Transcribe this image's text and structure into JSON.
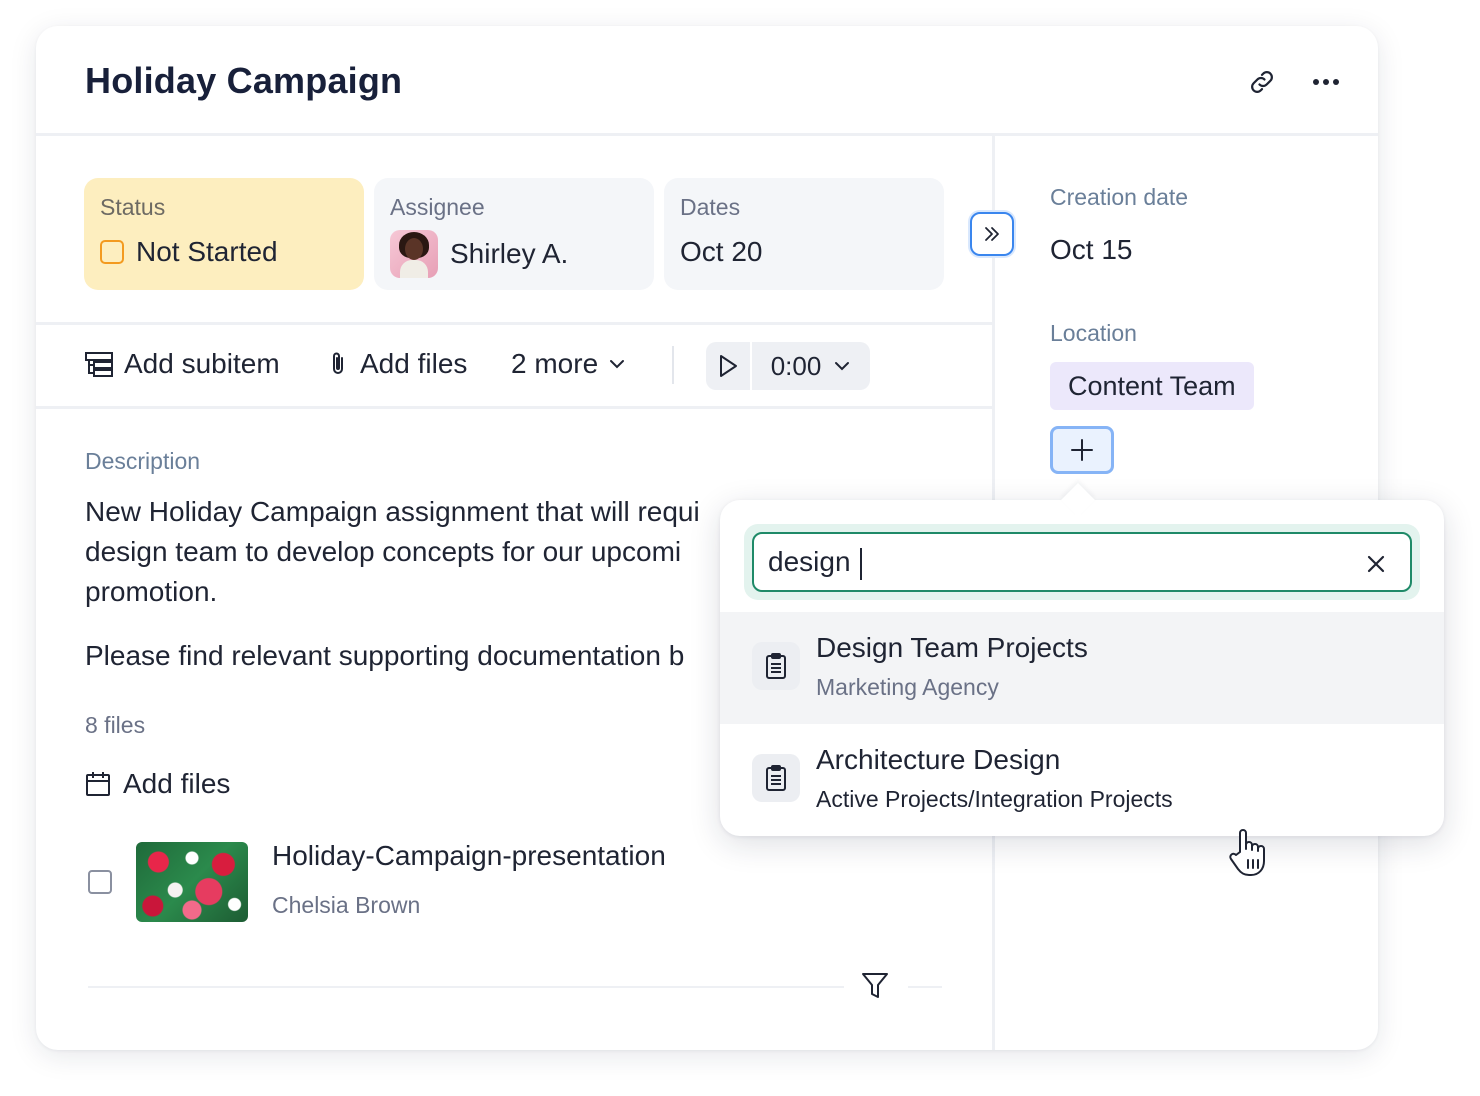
{
  "header": {
    "title": "Holiday Campaign",
    "link_icon": "link-icon",
    "more_icon": "more-horizontal-icon"
  },
  "properties": {
    "status": {
      "label": "Status",
      "value": "Not Started",
      "color": "#fdeebf"
    },
    "assignee": {
      "label": "Assignee",
      "value": "Shirley A."
    },
    "dates": {
      "label": "Dates",
      "value": "Oct 20"
    }
  },
  "toolbar": {
    "add_subitem": "Add subitem",
    "add_files": "Add files",
    "more": "2 more",
    "timer": "0:00"
  },
  "description": {
    "label": "Description",
    "para1": "New Holiday Campaign assignment that will requi",
    "para1_line2": "design team to develop concepts for our upcomi",
    "para1_line3": "promotion.",
    "para2": "Please find relevant supporting documentation b"
  },
  "files": {
    "count_label": "8 files",
    "add_files": "Add files",
    "items": [
      {
        "name": "Holiday-Campaign-presentation",
        "owner": "Chelsia Brown"
      }
    ]
  },
  "side": {
    "creation_label": "Creation date",
    "creation_value": "Oct 15",
    "location_label": "Location",
    "location_tag": "Content Team"
  },
  "dropdown": {
    "search_value": "design",
    "options": [
      {
        "title": "Design Team Projects",
        "subtitle": "Marketing Agency"
      },
      {
        "title": "Architecture Design",
        "subtitle": "Active Projects/Integration Projects"
      }
    ]
  },
  "colors": {
    "accent_blue": "#3a86ee",
    "search_green": "#1f8a68",
    "location_tag_bg": "#ece8fb",
    "status_bg": "#fdeebf"
  }
}
